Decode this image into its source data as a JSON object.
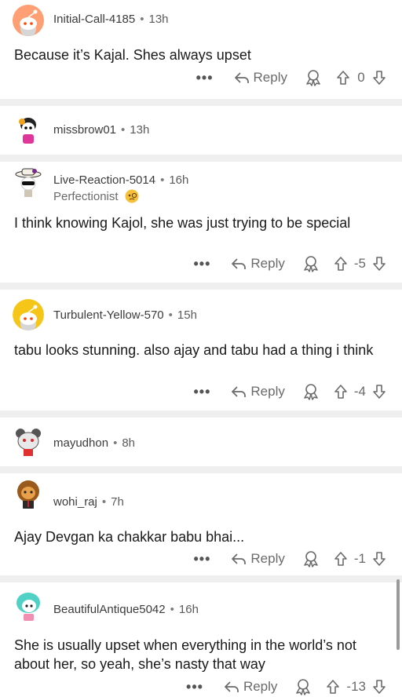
{
  "comments": [
    {
      "username": "Initial-Call-4185",
      "time": "13h",
      "flair": "",
      "body": "Because it’s Kajal. Shes always upset",
      "score": "0",
      "reply_label": "Reply",
      "avatar": "snoo-orange-icon"
    },
    {
      "username": "missbrow01",
      "time": "13h",
      "flair": "",
      "body": "",
      "score": "",
      "reply_label": "",
      "avatar": "snoo-custom-girl-icon"
    },
    {
      "username": "Live-Reaction-5014",
      "time": "16h",
      "flair": "Perfectionist",
      "body": "I think knowing Kajol, she was just trying to be special",
      "score": "-5",
      "reply_label": "Reply",
      "avatar": "snoo-hat-sunglasses-icon"
    },
    {
      "username": "Turbulent-Yellow-570",
      "time": "15h",
      "flair": "",
      "body": "tabu looks stunning. also ajay and tabu had a thing i think",
      "score": "-4",
      "reply_label": "Reply",
      "avatar": "snoo-yellow-icon"
    },
    {
      "username": "mayudhon",
      "time": "8h",
      "flair": "",
      "body": "",
      "score": "",
      "reply_label": "",
      "avatar": "snoo-bear-icon"
    },
    {
      "username": "wohi_raj",
      "time": "7h",
      "flair": "",
      "body": "Ajay Devgan ka chakkar babu bhai...",
      "score": "-1",
      "reply_label": "Reply",
      "avatar": "snoo-lion-icon"
    },
    {
      "username": "BeautifulAntique5042",
      "time": "16h",
      "flair": "",
      "body": "She is usually upset when everything in the world’s not about her, so yeah, she’s nasty that way",
      "score": "-13",
      "reply_label": "Reply",
      "avatar": "snoo-teal-hair-icon"
    }
  ],
  "more_label": "•••",
  "separator": "•"
}
